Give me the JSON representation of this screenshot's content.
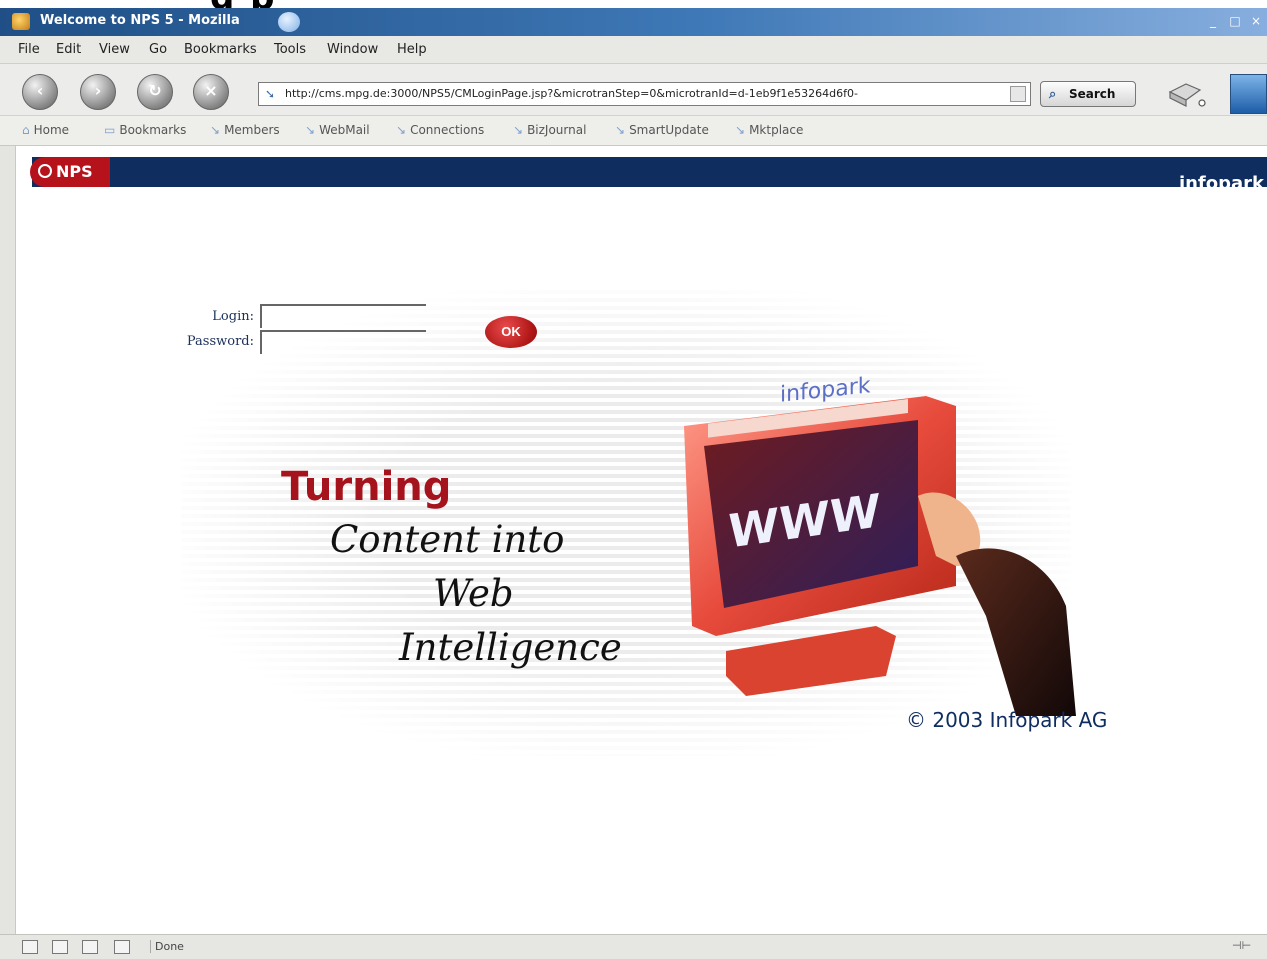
{
  "window": {
    "title": "Welcome to NPS 5 - Mozilla",
    "controls": [
      "_",
      "□",
      "×"
    ]
  },
  "menubar": [
    "File",
    "Edit",
    "View",
    "Go",
    "Bookmarks",
    "Tools",
    "Window",
    "Help"
  ],
  "navigation": {
    "url": "http://cms.mpg.de:3000/NPS5/CMLoginPage.jsp?&microtranStep=0&microtranId=d-1eb9f1e53264d6f0-",
    "search_label": "Search"
  },
  "bookmarks": [
    "Home",
    "Bookmarks",
    "Members",
    "WebMail",
    "Connections",
    "BizJournal",
    "SmartUpdate",
    "Mktplace"
  ],
  "page": {
    "logo_text": "NPS",
    "brand": "infopark",
    "login_label": "Login:",
    "password_label": "Password:",
    "ok_label": "OK",
    "tagline": [
      "Turning",
      "Content into",
      "Web",
      "Intelligence"
    ],
    "monitor_screen_text": [
      "infopark",
      "WWW"
    ],
    "copyright": "© 2003 Infopark AG"
  },
  "statusbar": {
    "text": "Done"
  },
  "colors": {
    "nps_navy": "#0f2d5f",
    "nps_red": "#b5121b",
    "title_blue": "#1f4f86"
  }
}
